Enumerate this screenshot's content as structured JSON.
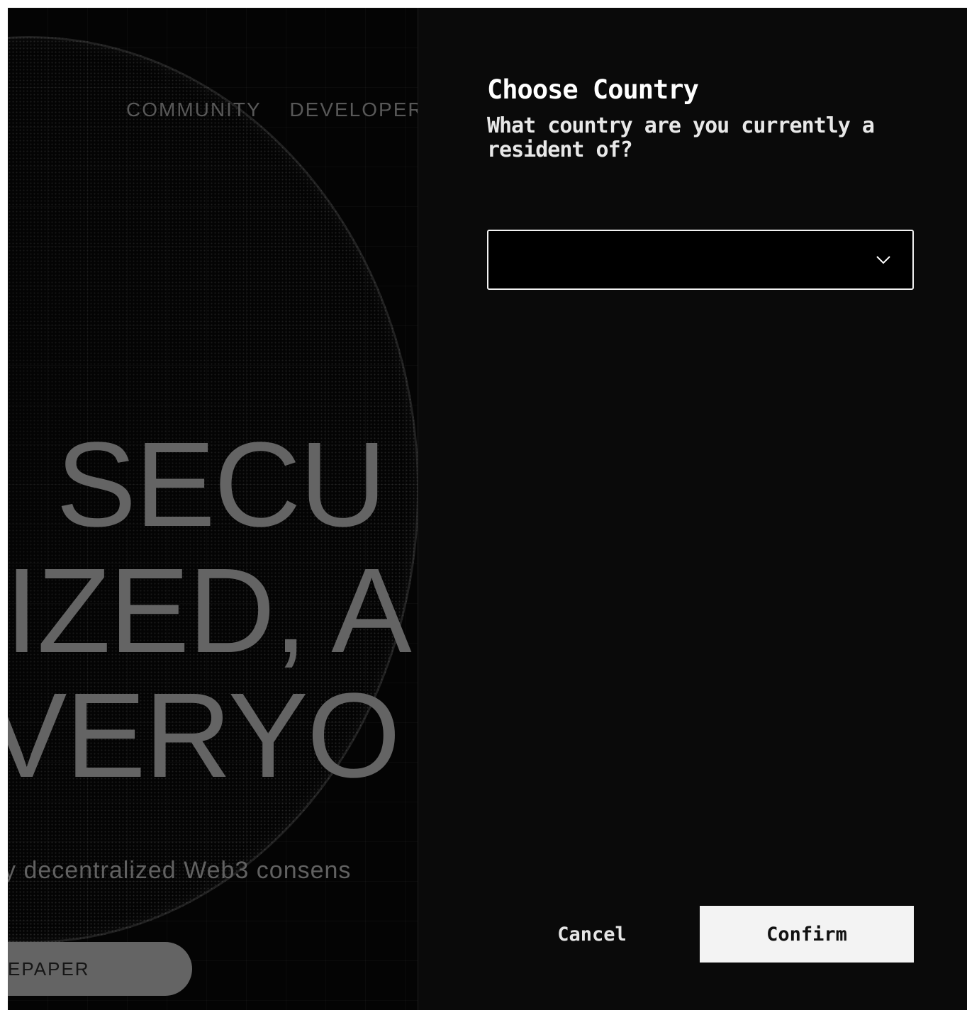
{
  "background_page": {
    "nav": [
      "COMMUNITY",
      "DEVELOPER"
    ],
    "hero_lines": [
      "SECU",
      "IZED, A",
      "VERYO"
    ],
    "subtitle": "y decentralized Web3 consens",
    "button_label": "EPAPER"
  },
  "modal": {
    "title": "Choose Country",
    "question": "What country are you currently a resident of?",
    "select": {
      "value": "",
      "icon": "chevron-down-icon"
    },
    "cancel_label": "Cancel",
    "confirm_label": "Confirm"
  },
  "colors": {
    "modal_bg": "#0a0a0a",
    "text": "#ffffff",
    "confirm_bg": "#f3f3f3",
    "background_text": "#7a7a7a"
  }
}
